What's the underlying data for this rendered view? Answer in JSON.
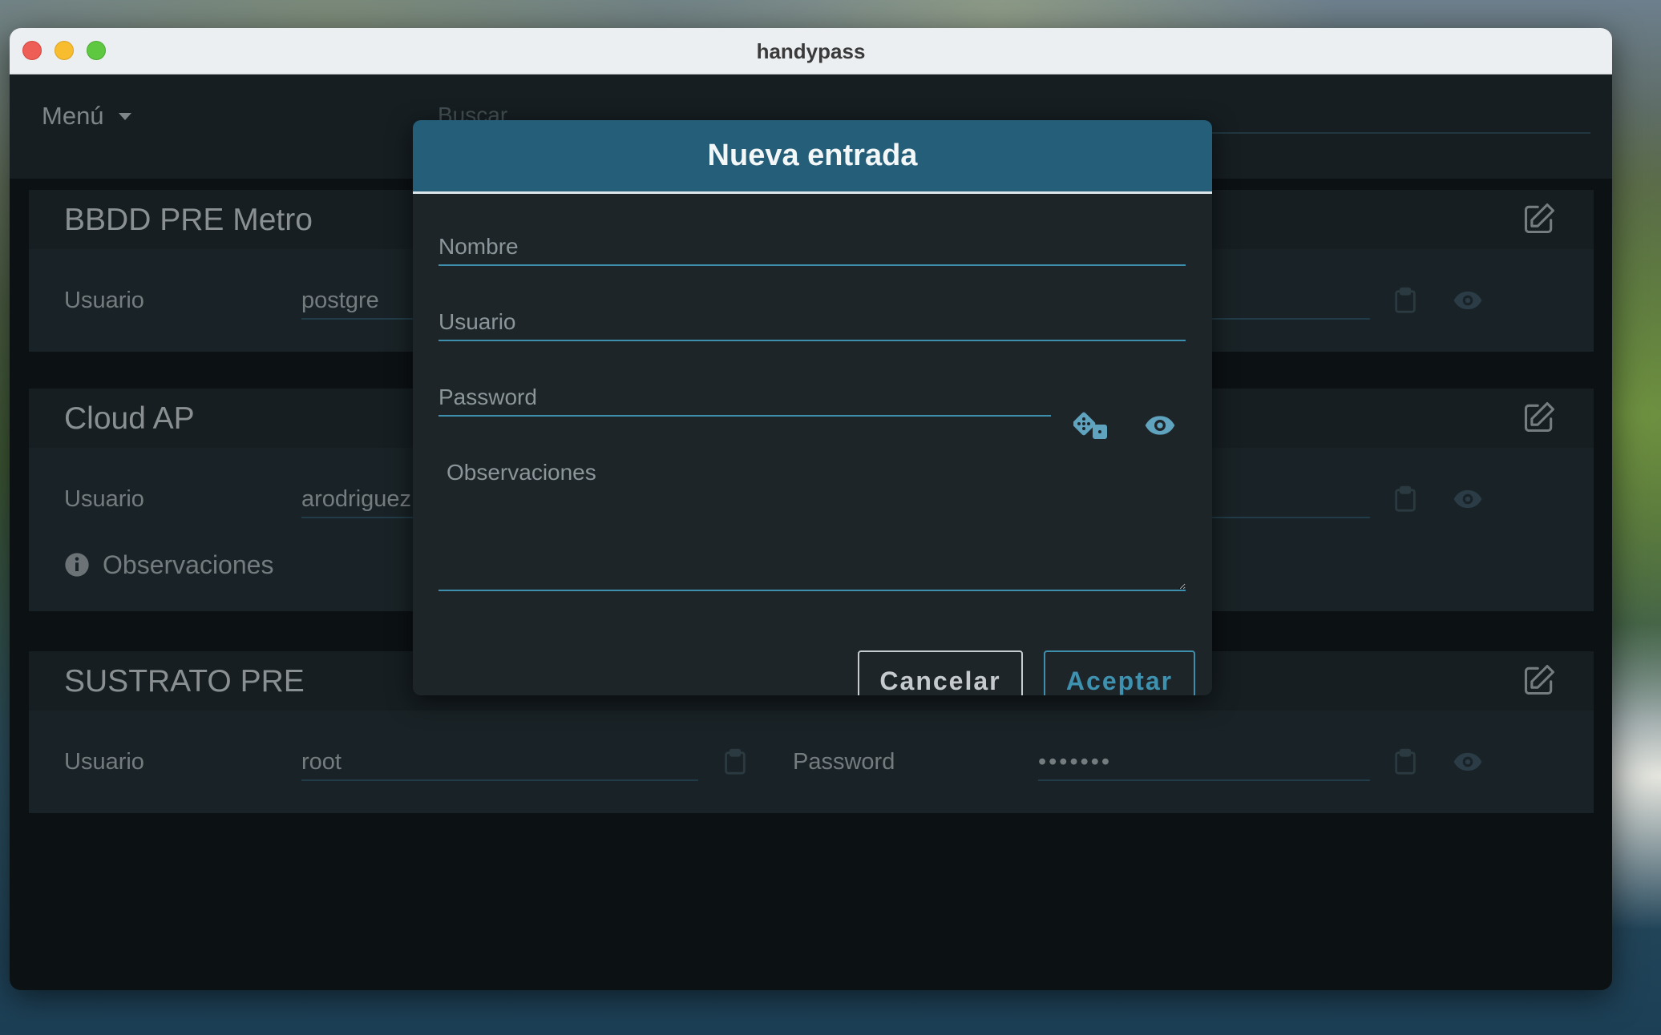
{
  "window": {
    "title": "handypass"
  },
  "appbar": {
    "menu_label": "Menú",
    "search_placeholder": "Buscar..."
  },
  "entries": [
    {
      "title": "BBDD PRE Metro",
      "user_label": "Usuario",
      "user_value": "postgre"
    },
    {
      "title": "Cloud AP",
      "user_label": "Usuario",
      "user_value": "arodriguez",
      "notes_label": "Observaciones"
    },
    {
      "title": "SUSTRATO PRE",
      "user_label": "Usuario",
      "user_value": "root",
      "password_label": "Password",
      "password_value": "•••••••"
    }
  ],
  "modal": {
    "title": "Nueva entrada",
    "name_placeholder": "Nombre",
    "user_placeholder": "Usuario",
    "password_placeholder": "Password",
    "notes_placeholder": "Observaciones",
    "cancel_label": "Cancelar",
    "accept_label": "Aceptar"
  },
  "icons": {
    "edit": "pencil-square-icon",
    "copy": "clipboard-icon",
    "reveal": "eye-icon",
    "generate": "dice-icon",
    "info": "info-circle-icon",
    "menu_caret": "caret-down-icon"
  },
  "colors": {
    "accent": "#3d8fad",
    "header": "#255e79",
    "surface": "#1c262b",
    "text": "#a7b0b5"
  }
}
